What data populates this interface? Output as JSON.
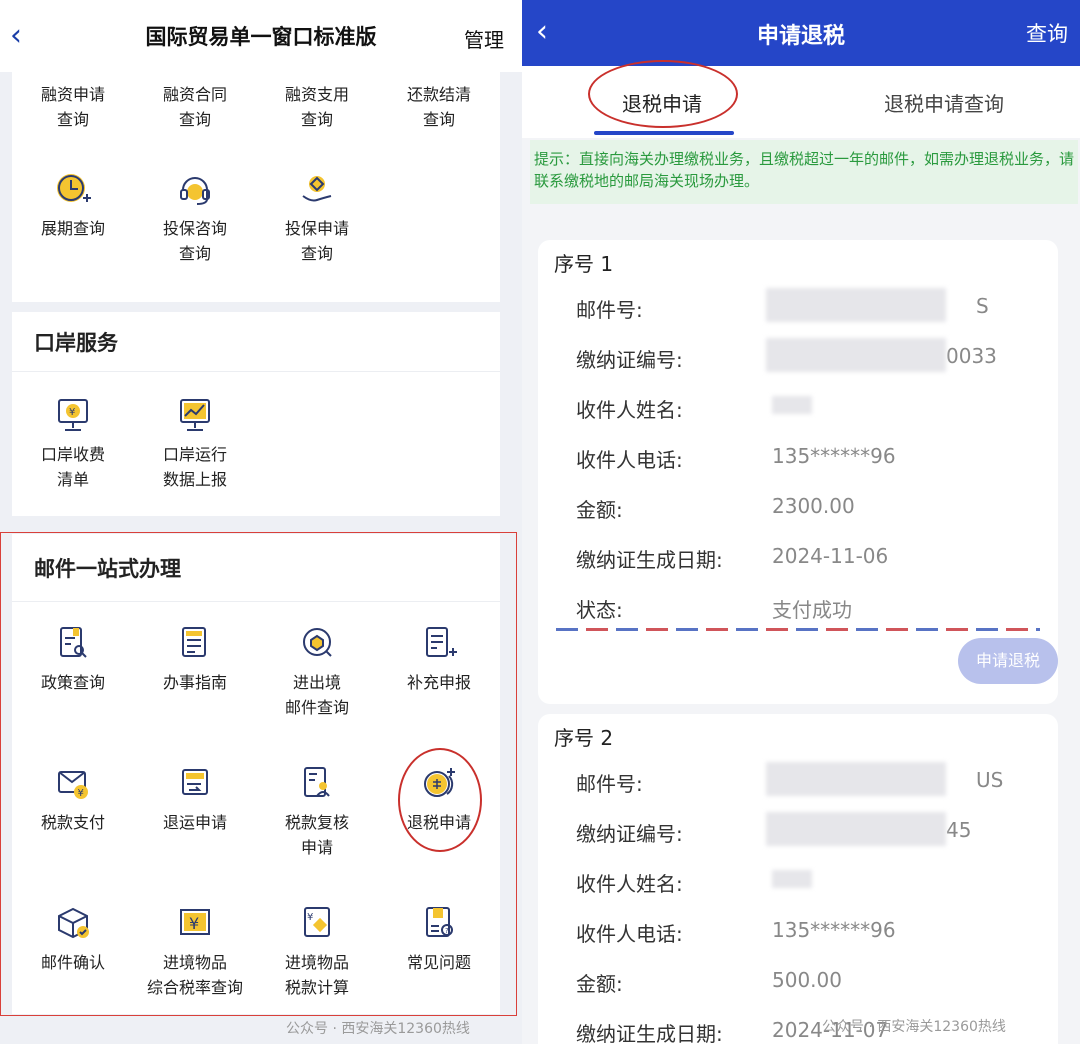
{
  "left": {
    "header": {
      "back": "‹",
      "title": "国际贸易单一窗口标准版",
      "manage": "管理"
    },
    "finance": {
      "row1": [
        "融资申请\n查询",
        "融资合同\n查询",
        "融资支用\n查询",
        "还款结清\n查询"
      ],
      "row2": [
        {
          "label": "展期查询",
          "icon": "clock-plus-icon"
        },
        {
          "label": "投保咨询\n查询",
          "icon": "headset-icon"
        },
        {
          "label": "投保申请\n查询",
          "icon": "hand-coin-icon"
        }
      ]
    },
    "port": {
      "title": "口岸服务",
      "items": [
        {
          "label": "口岸收费\n清单",
          "icon": "monitor-yen-icon"
        },
        {
          "label": "口岸运行\n数据上报",
          "icon": "chart-board-icon"
        }
      ]
    },
    "mail": {
      "title": "邮件一站式办理",
      "items": [
        {
          "label": "政策查询",
          "icon": "doc-search-icon"
        },
        {
          "label": "办事指南",
          "icon": "guide-doc-icon"
        },
        {
          "label": "进出境\n邮件查询",
          "icon": "package-search-icon"
        },
        {
          "label": "补充申报",
          "icon": "doc-plus-icon"
        },
        {
          "label": "税款支付",
          "icon": "envelope-yen-icon"
        },
        {
          "label": "退运申请",
          "icon": "return-icon"
        },
        {
          "label": "税款复核\n申请",
          "icon": "doc-user-icon"
        },
        {
          "label": "退税申请",
          "icon": "coin-refund-icon"
        },
        {
          "label": "邮件确认",
          "icon": "box-check-icon"
        },
        {
          "label": "进境物品\n综合税率查询",
          "icon": "yen-receipt-icon"
        },
        {
          "label": "进境物品\n税款计算",
          "icon": "yen-calc-icon"
        },
        {
          "label": "常见问题",
          "icon": "faq-icon"
        }
      ]
    },
    "watermark": "公众号 · 西安海关12360热线"
  },
  "right": {
    "header": {
      "back": "‹",
      "title": "申请退税",
      "query": "查询"
    },
    "tabs": [
      "退税申请",
      "退税申请查询"
    ],
    "tip": "提示：直接向海关办理缴税业务，且缴税超过一年的邮件，如需办理退税业务，请联系缴税地的邮局海关现场办理。",
    "records": [
      {
        "seq": "序号 1",
        "fields": [
          {
            "k": "邮件号:",
            "v": "S"
          },
          {
            "k": "缴纳证编号:",
            "v": "0033"
          },
          {
            "k": "收件人姓名:",
            "v": ""
          },
          {
            "k": "收件人电话:",
            "v": "135******96"
          },
          {
            "k": "金额:",
            "v": "2300.00"
          },
          {
            "k": "缴纳证生成日期:",
            "v": "2024-11-06"
          },
          {
            "k": "状态:",
            "v": "支付成功"
          }
        ],
        "button": "申请退税"
      },
      {
        "seq": "序号 2",
        "fields": [
          {
            "k": "邮件号:",
            "v": "US"
          },
          {
            "k": "缴纳证编号:",
            "v": "45"
          },
          {
            "k": "收件人姓名:",
            "v": ""
          },
          {
            "k": "收件人电话:",
            "v": "135******96"
          },
          {
            "k": "金额:",
            "v": "500.00"
          },
          {
            "k": "缴纳证生成日期:",
            "v": "2024-11-07"
          }
        ]
      }
    ],
    "watermark": "公众号 · 西安海关12360热线"
  }
}
